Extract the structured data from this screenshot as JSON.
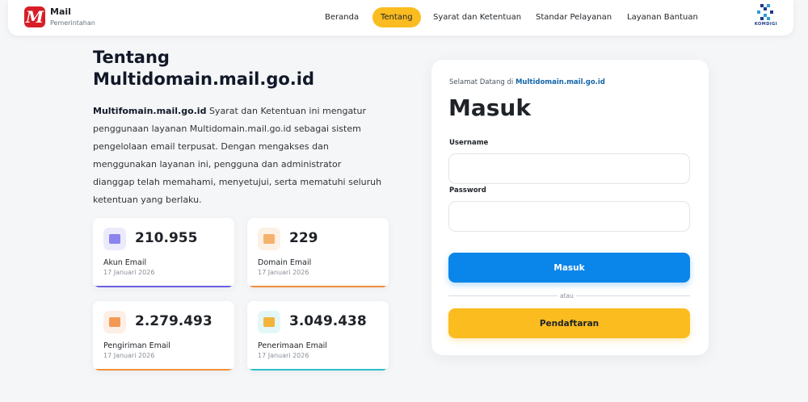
{
  "brand": {
    "title": "Mail",
    "subtitle": "Pemerintahan",
    "logo_letter": "M",
    "logo_color": "#d71e28"
  },
  "nav": {
    "items": [
      {
        "label": "Beranda",
        "active": false
      },
      {
        "label": "Tentang",
        "active": true
      },
      {
        "label": "Syarat dan Ketentuan",
        "active": false
      },
      {
        "label": "Standar Pelayanan",
        "active": false
      },
      {
        "label": "Layanan Bantuan",
        "active": false
      }
    ],
    "partner_logo_text": "KOMDIGI",
    "active_color": "#fbbc20"
  },
  "about": {
    "heading": "Tentang Multidomain.mail.go.id",
    "description_bold": "Multifomain.mail.go.id",
    "description_rest": " Syarat dan Ketentuan ini mengatur penggunaan layanan Multidomain.mail.go.id sebagai sistem pengelolaan email terpusat. Dengan mengakses dan menggunakan layanan ini, pengguna dan administrator dianggap telah memahami, menyetujui, serta mematuhi seluruh ketentuan yang berlaku."
  },
  "stats": [
    {
      "value": "210.955",
      "label": "Akun Email",
      "date": "17 Januari 2026",
      "icon": "accounts-icon",
      "accent": "#6a5fe0",
      "icon_bg": "#ecebfb"
    },
    {
      "value": "229",
      "label": "Domain Email",
      "date": "17 Januari 2026",
      "icon": "domain-icon",
      "accent": "#f08c3a",
      "icon_bg": "#fdf0e4"
    },
    {
      "value": "2.279.493",
      "label": "Pengiriman Email",
      "date": "17 Januari 2026",
      "icon": "send-mail-icon",
      "accent": "#f0913a",
      "icon_bg": "#fdefe6"
    },
    {
      "value": "3.049.438",
      "label": "Penerimaan Email",
      "date": "17 Januari 2026",
      "icon": "receive-mail-icon",
      "accent": "#2bbfc9",
      "icon_bg": "#e3f7f8"
    }
  ],
  "login": {
    "welcome_prefix": "Selamat Datang di",
    "welcome_domain": "Multidomain.mail.go.id",
    "title": "Masuk",
    "username_label": "Username",
    "username_value": "",
    "password_label": "Password",
    "password_value": "",
    "submit_label": "Masuk",
    "divider_text": "atau",
    "register_label": "Pendaftaran",
    "primary_color": "#0a85e9"
  }
}
